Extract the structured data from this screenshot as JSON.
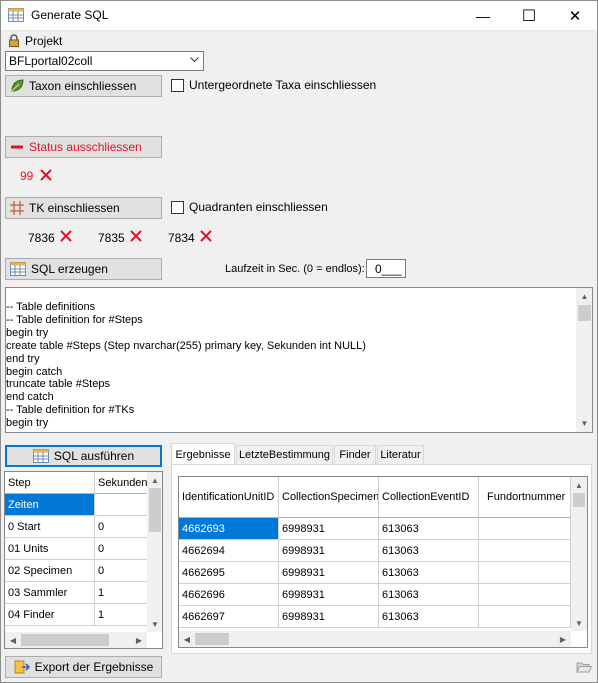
{
  "window": {
    "title": "Generate SQL",
    "minimize_glyph": "—",
    "maximize_glyph": "☐",
    "close_glyph": "✕"
  },
  "projekt": {
    "label": "Projekt",
    "value": "BFLportal02coll"
  },
  "taxon": {
    "button_label": "Taxon einschliessen",
    "checkbox_label": "Untergeordnete Taxa einschliessen"
  },
  "status": {
    "button_label": "Status ausschliessen",
    "items": [
      "99"
    ]
  },
  "tk": {
    "button_label": "TK einschliessen",
    "checkbox_label": "Quadranten einschliessen",
    "items": [
      "7836",
      "7835",
      "7834"
    ]
  },
  "sql": {
    "button_label": "SQL erzeugen",
    "laufzeit_label": "Laufzeit in Sec. (0 = endlos):",
    "laufzeit_value": "0___",
    "lines": [
      "-- Table definitions",
      "-- Table definition for #Steps",
      "begin try",
      "create table #Steps (Step nvarchar(255) primary key, Sekunden int NULL)",
      "end try",
      "begin catch",
      "truncate table #Steps",
      "end catch",
      "-- Table definition for #TKs",
      "begin try"
    ]
  },
  "execute": {
    "button_label": "SQL ausführen"
  },
  "steps_grid": {
    "columns": [
      "Step",
      "Sekunden"
    ],
    "rows": [
      [
        "Zeiten",
        ""
      ],
      [
        "0 Start",
        "0"
      ],
      [
        "01 Units",
        "0"
      ],
      [
        "02 Specimen",
        "0"
      ],
      [
        "03 Sammler",
        "1"
      ],
      [
        "04 Finder",
        "1"
      ]
    ]
  },
  "tabs": [
    "Ergebnisse",
    "LetzteBestimmung",
    "Finder",
    "Literatur"
  ],
  "results_grid": {
    "columns": [
      "IdentificationUnitID",
      "CollectionSpecimen",
      "CollectionEventID",
      "Fundortnummer"
    ],
    "rows": [
      [
        "4662693",
        "6998931",
        "613063",
        ""
      ],
      [
        "4662694",
        "6998931",
        "613063",
        ""
      ],
      [
        "4662695",
        "6998931",
        "613063",
        ""
      ],
      [
        "4662696",
        "6998931",
        "613063",
        ""
      ],
      [
        "4662697",
        "6998931",
        "613063",
        ""
      ]
    ]
  },
  "export": {
    "button_label": "Export der Ergebnisse"
  },
  "colors": {
    "status_red": "#e81123",
    "selection_blue": "#0078d7",
    "leaf_green": "#5a8f29"
  }
}
